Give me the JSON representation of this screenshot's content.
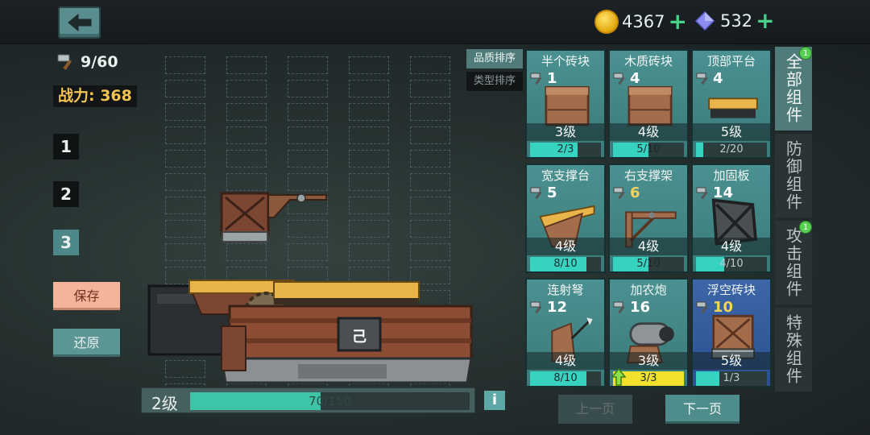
{
  "header": {
    "back_icon": "arrow-left-icon",
    "gold": {
      "value": "4367",
      "icon": "gold-coin-icon",
      "plus": "+"
    },
    "gems": {
      "value": "532",
      "icon": "diamond-icon",
      "plus": "+"
    }
  },
  "left": {
    "hammer_count": "9/60",
    "power_label": "战力: 368",
    "slots": [
      "1",
      "2",
      "3"
    ],
    "active_slot": 3,
    "save_label": "保存",
    "reset_label": "还原"
  },
  "vehicle": {
    "level_label": "2级",
    "xp_text": "70/150",
    "xp_current": 70,
    "xp_max": 150,
    "cabin_symbol": "己",
    "info_label": "i"
  },
  "sort": {
    "quality_label": "品质排序",
    "type_label": "类型排序"
  },
  "cards": [
    {
      "name": "半个砖块",
      "cost": "1",
      "cost_color": "white",
      "level": "3级",
      "progress_text": "2/3",
      "progress": 0.667,
      "rarity": "green",
      "art": "crate-half"
    },
    {
      "name": "木质砖块",
      "cost": "4",
      "cost_color": "white",
      "level": "4级",
      "progress_text": "5/10",
      "progress": 0.5,
      "rarity": "green",
      "art": "crate"
    },
    {
      "name": "顶部平台",
      "cost": "4",
      "cost_color": "white",
      "level": "5级",
      "progress_text": "2/20",
      "progress": 0.1,
      "rarity": "green",
      "art": "platform"
    },
    {
      "name": "宽支撑台",
      "cost": "5",
      "cost_color": "white",
      "level": "4级",
      "progress_text": "8/10",
      "progress": 0.8,
      "rarity": "green",
      "art": "wide-support"
    },
    {
      "name": "右支撑架",
      "cost": "6",
      "cost_color": "gold",
      "level": "4级",
      "progress_text": "5/10",
      "progress": 0.5,
      "rarity": "green",
      "art": "right-bracket"
    },
    {
      "name": "加固板",
      "cost": "14",
      "cost_color": "white",
      "level": "4级",
      "progress_text": "4/10",
      "progress": 0.4,
      "rarity": "green",
      "art": "reinforced-plate"
    },
    {
      "name": "连射弩",
      "cost": "12",
      "cost_color": "white",
      "level": "4级",
      "progress_text": "8/10",
      "progress": 0.8,
      "rarity": "green",
      "art": "crossbow"
    },
    {
      "name": "加农炮",
      "cost": "16",
      "cost_color": "white",
      "level": "3级",
      "progress_text": "3/3",
      "progress": 1.0,
      "rarity": "green",
      "art": "cannon",
      "upgrade_ready": true
    },
    {
      "name": "浮空砖块",
      "cost": "10",
      "cost_color": "gold",
      "level": "5级",
      "progress_text": "1/3",
      "progress": 0.333,
      "rarity": "blue",
      "art": "floating-crate"
    }
  ],
  "tabs": [
    {
      "label": "全部组件",
      "active": true,
      "badge": "1"
    },
    {
      "label": "防御组件",
      "active": false,
      "badge": ""
    },
    {
      "label": "攻击组件",
      "active": false,
      "badge": "1"
    },
    {
      "label": "特殊组件",
      "active": false,
      "badge": ""
    }
  ],
  "pagination": {
    "prev_label": "上一页",
    "next_label": "下一页"
  },
  "colors": {
    "accent_teal": "#4f7c7b",
    "progress_fill": "#35d3c0",
    "power_gold": "#f3c452",
    "save_btn": "#f2b49a"
  }
}
